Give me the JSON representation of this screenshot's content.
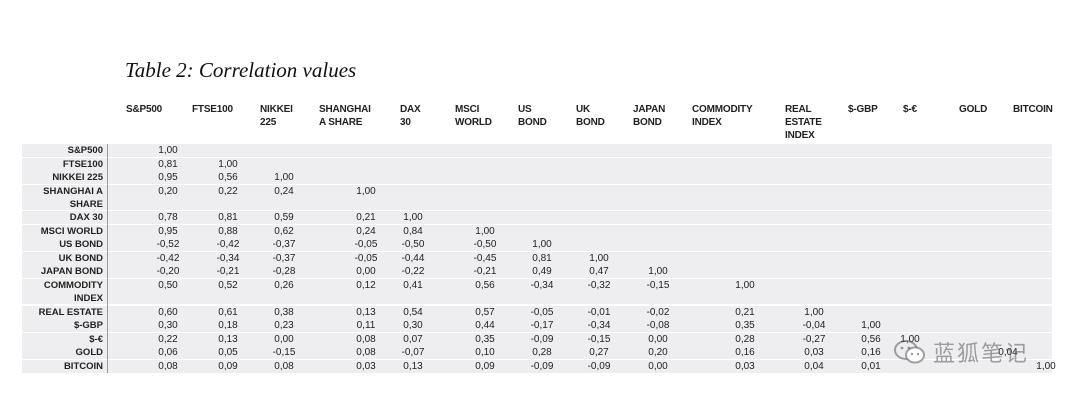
{
  "caption": "Table 2: Correlation values",
  "columns": [
    "S&P500",
    "FTSE100",
    "NIKKEI\n225",
    "SHANGHAI\nA SHARE",
    "DAX\n30",
    "MSCI\nWORLD",
    "US\nBOND",
    "UK\nBOND",
    "JAPAN\nBOND",
    "COMMODITY\nINDEX",
    "REAL\nESTATE\nINDEX",
    "$-GBP",
    "$-€",
    "GOLD",
    "BITCOIN"
  ],
  "rows": [
    {
      "label": "S&P500",
      "values": [
        "1,00"
      ]
    },
    {
      "label": "FTSE100",
      "values": [
        "0,81",
        "1,00"
      ]
    },
    {
      "label": "NIKKEI 225",
      "values": [
        "0,95",
        "0,56",
        "1,00"
      ]
    },
    {
      "label": "SHANGHAI A\nSHARE",
      "values": [
        "0,20",
        "0,22",
        "0,24",
        "1,00"
      ]
    },
    {
      "label": "DAX 30",
      "values": [
        "0,78",
        "0,81",
        "0,59",
        "0,21",
        "1,00"
      ]
    },
    {
      "label": "MSCI WORLD",
      "values": [
        "0,95",
        "0,88",
        "0,62",
        "0,24",
        "0,84",
        "1,00"
      ]
    },
    {
      "label": "US BOND",
      "values": [
        "-0,52",
        "-0,42",
        "-0,37",
        "-0,05",
        "-0,50",
        "-0,50",
        "1,00"
      ]
    },
    {
      "label": "UK BOND",
      "values": [
        "-0,42",
        "-0,34",
        "-0,37",
        "-0,05",
        "-0,44",
        "-0,45",
        "0,81",
        "1,00"
      ]
    },
    {
      "label": "JAPAN BOND",
      "values": [
        "-0,20",
        "-0,21",
        "-0,28",
        "0,00",
        "-0,22",
        "-0,21",
        "0,49",
        "0,47",
        "1,00"
      ]
    },
    {
      "label": "COMMODITY\nINDEX",
      "values": [
        "0,50",
        "0,52",
        "0,26",
        "0,12",
        "0,41",
        "0,56",
        "-0,34",
        "-0,32",
        "-0,15",
        "1,00"
      ]
    },
    {
      "label": "REAL ESTATE",
      "values": [
        "0,60",
        "0,61",
        "0,38",
        "0,13",
        "0,54",
        "0,57",
        "-0,05",
        "-0,01",
        "-0,02",
        "0,21",
        "1,00"
      ]
    },
    {
      "label": "$-GBP",
      "values": [
        "0,30",
        "0,18",
        "0,23",
        "0,11",
        "0,30",
        "0,44",
        "-0,17",
        "-0,34",
        "-0,08",
        "0,35",
        "-0,04",
        "1,00"
      ]
    },
    {
      "label": "$-€",
      "values": [
        "0,22",
        "0,13",
        "0,00",
        "0,08",
        "0,07",
        "0,35",
        "-0,09",
        "-0,15",
        "0,00",
        "0,28",
        "-0,27",
        "0,56",
        "1,00"
      ]
    },
    {
      "label": "GOLD",
      "values": [
        "0,06",
        "0,05",
        "-0,15",
        "0,08",
        "-0,07",
        "0,10",
        "0,28",
        "0,27",
        "0,20",
        "0,16",
        "0,03",
        "0,16",
        "",
        "0,04"
      ]
    },
    {
      "label": "BITCOIN",
      "values": [
        "0,08",
        "0,09",
        "0,08",
        "0,03",
        "0,13",
        "0,09",
        "-0,09",
        "-0,09",
        "0,00",
        "0,03",
        "0,04",
        "0,01",
        "",
        "",
        "1,00"
      ]
    }
  ],
  "watermark": {
    "text": "蓝狐笔记",
    "icon": "wechat-icon"
  }
}
